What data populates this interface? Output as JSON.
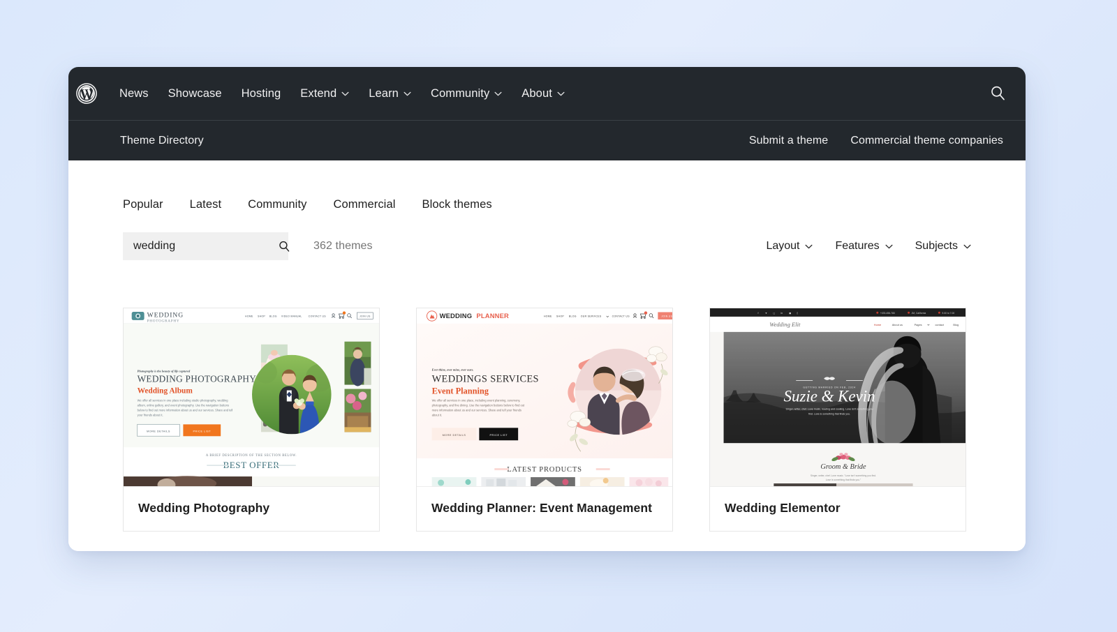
{
  "site": {
    "logo_icon": "wordpress-logo-icon"
  },
  "topnav": {
    "items": [
      {
        "label": "News",
        "has_caret": false
      },
      {
        "label": "Showcase",
        "has_caret": false
      },
      {
        "label": "Hosting",
        "has_caret": false
      },
      {
        "label": "Extend",
        "has_caret": true
      },
      {
        "label": "Learn",
        "has_caret": true
      },
      {
        "label": "Community",
        "has_caret": true
      },
      {
        "label": "About",
        "has_caret": true
      }
    ],
    "search_icon": "search-icon"
  },
  "subbar": {
    "title": "Theme Directory",
    "links": [
      {
        "label": "Submit a theme"
      },
      {
        "label": "Commercial theme companies"
      }
    ]
  },
  "tabs": [
    {
      "label": "Popular",
      "active": true
    },
    {
      "label": "Latest",
      "active": false
    },
    {
      "label": "Community",
      "active": false
    },
    {
      "label": "Commercial",
      "active": false
    },
    {
      "label": "Block themes",
      "active": false
    }
  ],
  "search": {
    "value": "wedding",
    "placeholder": "Search themes",
    "icon": "search-icon"
  },
  "results": {
    "count_label": "362 themes"
  },
  "filters": [
    {
      "label": "Layout",
      "icon": "chevron-down-icon"
    },
    {
      "label": "Features",
      "icon": "chevron-down-icon"
    },
    {
      "label": "Subjects",
      "icon": "chevron-down-icon"
    }
  ],
  "themes": [
    {
      "title": "Wedding Photography",
      "preview": {
        "brand": "WEDDING",
        "brand_sub": "PHOTOGRAPHY",
        "nav": [
          "HOME",
          "SHOP",
          "BLOG",
          "VIDEO MANUAL",
          "CONTACT US"
        ],
        "cta": "JOIN US",
        "eyebrow": "Photography is the beauty of life captured",
        "heading": "WEDDING PHOTOGRAPHY",
        "subheading": "Wedding Album",
        "body": "We offer all services in one place including studio photography, wedding album, online gallery, and event photography. Use the navigation buttons below to find out more information about us and our services. Share and tell your friends about it.",
        "btn_outline": "MORE DETAILS",
        "btn_solid": "PRICE LIST",
        "section_eyebrow": "A BRIEF DESCRIPTION OF THE SECTION BELOW.",
        "section_title": "BEST OFFER",
        "accent": "#f1761e",
        "heading_color": "#3f4a52",
        "sub_color": "#e2542a"
      }
    },
    {
      "title": "Wedding Planner: Event Management",
      "preview": {
        "brand": "WEDDING",
        "brand_accent": "PLANNER",
        "nav": [
          "HOME",
          "SHOP",
          "BLOG",
          "OUR SERVICES",
          "CONTACT US"
        ],
        "cta": "JOIN US",
        "eyebrow": "Ever thine, ever mine, ever ours.",
        "heading": "WEDDINGS SERVICES",
        "subheading": "Event Planning",
        "body": "We offer all services in one place, including event planning, ceremony, photography, and fine dining. Use the navigation buttons below to find out more information about us and our services. Share and tell your friends about it.",
        "btn_outline": "MORE DETAILS",
        "btn_solid": "PRICE LIST",
        "section_title": "LATEST PRODUCTS",
        "accent": "#e8604d",
        "heading_color": "#2b2b2b",
        "sub_color": "#e2542a"
      }
    },
    {
      "title": "Wedding Elementor",
      "preview": {
        "brand": "Wedding Elit",
        "nav": [
          "Home",
          "About us",
          "Pages",
          "contact",
          "Blog"
        ],
        "topbar_phone": "+033-456-780",
        "topbar_location": "JM, California",
        "topbar_hours": "9.00 to 7.00",
        "hero_eyebrow": "GETTING MARRIED ON FEB, 2024",
        "hero_names": "Suzie & Kevin",
        "hero_body": "Singer, writer, chef. Love music, reading and cooking. Love isn't something you find. Love is something that finds you.",
        "section_title": "Groom & Bride",
        "section_body": "Singer, writer, chef. Love music. \"Love isn't something you find. Love is something that finds you.\"",
        "accent": "#c0392b"
      }
    }
  ]
}
